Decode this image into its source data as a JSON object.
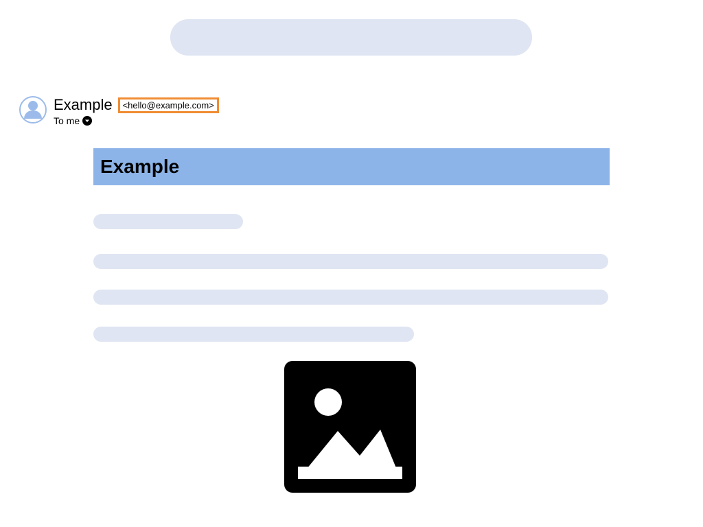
{
  "sender": {
    "name": "Example",
    "email": "<hello@example.com>",
    "to": "To me"
  },
  "subject": "Example"
}
